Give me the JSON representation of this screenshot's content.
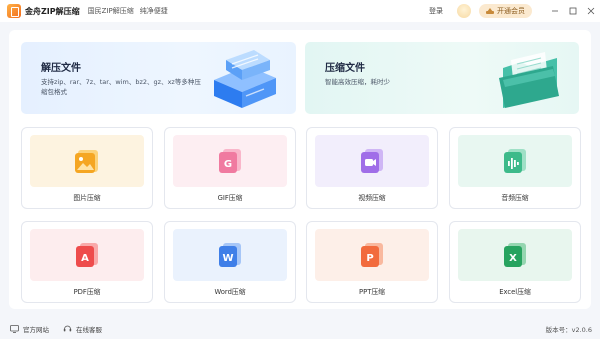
{
  "titlebar": {
    "app_name": "金舟ZIP解压缩",
    "slogan_1": "国民ZIP解压缩",
    "slogan_2": "纯净便捷",
    "login": "登录",
    "vip_button": "开通会员",
    "min_icon": "minus-icon",
    "max_icon": "square-icon",
    "close_icon": "close-icon"
  },
  "hero": {
    "decompress": {
      "title": "解压文件",
      "desc": "支持zip、rar、7z、tar、wim、bz2、gz、xz等多种压缩包格式"
    },
    "compress": {
      "title": "压缩文件",
      "desc": "智能高效压缩，耗时少"
    }
  },
  "cards": [
    {
      "label": "图片压缩",
      "bg": "#fdf3e0",
      "accent": "#f5a623",
      "icon": "image-icon"
    },
    {
      "label": "GIF压缩",
      "bg": "#fdeef2",
      "accent": "#f07aa0",
      "icon": "gif-icon"
    },
    {
      "label": "视频压缩",
      "bg": "#f2eefc",
      "accent": "#a06ee8",
      "icon": "video-icon"
    },
    {
      "label": "音频压缩",
      "bg": "#e8f7f1",
      "accent": "#3dba8a",
      "icon": "audio-icon"
    },
    {
      "label": "PDF压缩",
      "bg": "#fdedee",
      "accent": "#ee4c4c",
      "icon": "pdf-icon"
    },
    {
      "label": "Word压缩",
      "bg": "#eaf2fd",
      "accent": "#3f7fe8",
      "icon": "word-icon"
    },
    {
      "label": "PPT压缩",
      "bg": "#fdefe8",
      "accent": "#f26b3d",
      "icon": "ppt-icon"
    },
    {
      "label": "Excel压缩",
      "bg": "#e8f6ee",
      "accent": "#27a35f",
      "icon": "excel-icon"
    }
  ],
  "card_glyphs": {
    "gif": "G",
    "pdf": "A",
    "word": "W",
    "ppt": "P",
    "excel": "X"
  },
  "footer": {
    "website": "官方网站",
    "service": "在线客服",
    "version": "版本号：v2.0.6"
  }
}
